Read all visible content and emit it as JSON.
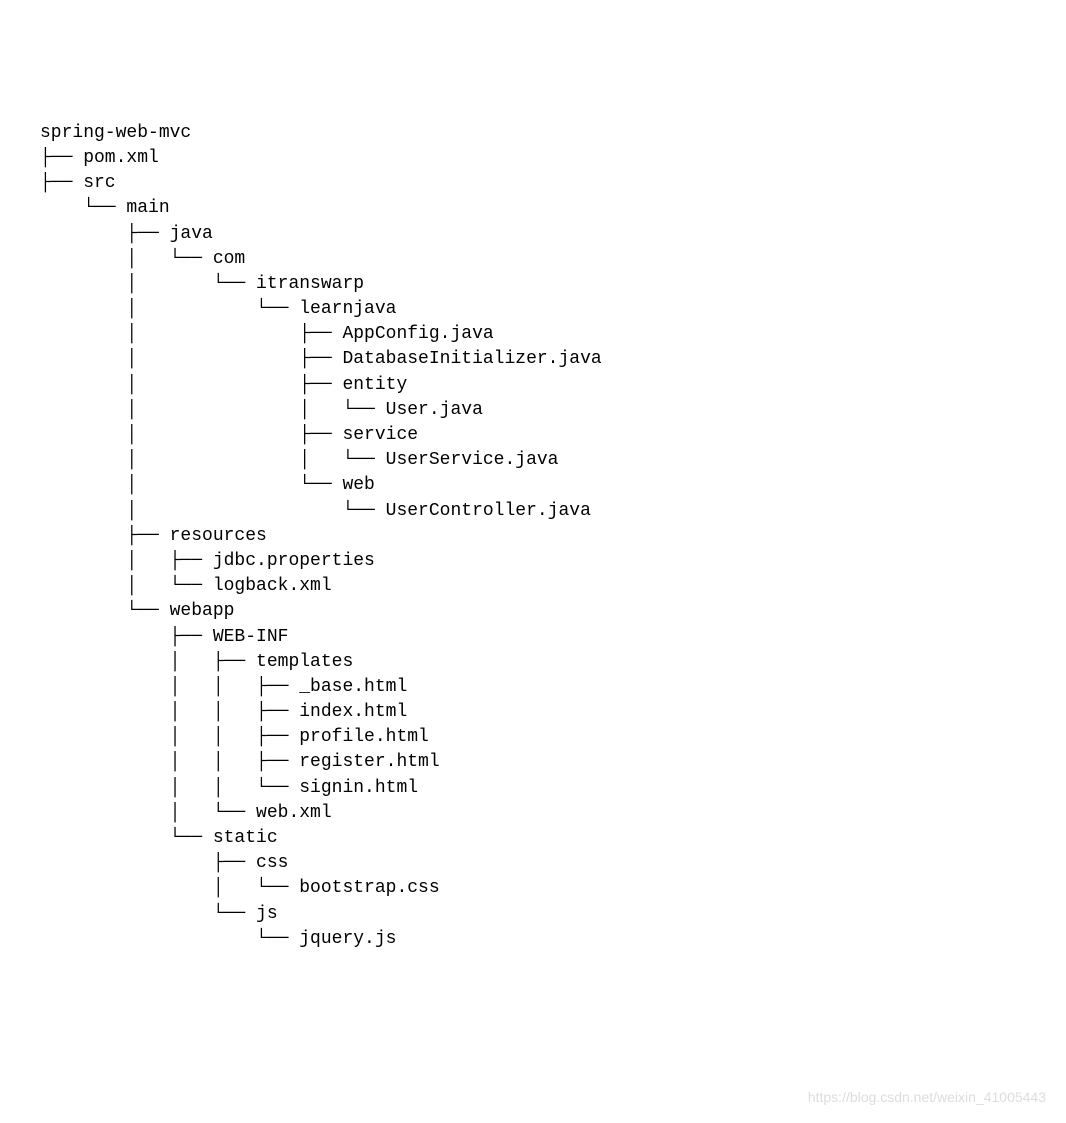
{
  "tree": {
    "lines": [
      "spring-web-mvc",
      "├── pom.xml",
      "├── src",
      "    └── main",
      "        ├── java",
      "        │   └── com",
      "        │       └── itranswarp",
      "        │           └── learnjava",
      "        │               ├── AppConfig.java",
      "        │               ├── DatabaseInitializer.java",
      "        │               ├── entity",
      "        │               │   └── User.java",
      "        │               ├── service",
      "        │               │   └── UserService.java",
      "        │               └── web",
      "        │                   └── UserController.java",
      "        ├── resources",
      "        │   ├── jdbc.properties",
      "        │   └── logback.xml",
      "        └── webapp",
      "            ├── WEB-INF",
      "            │   ├── templates",
      "            │   │   ├── _base.html",
      "            │   │   ├── index.html",
      "            │   │   ├── profile.html",
      "            │   │   ├── register.html",
      "            │   │   └── signin.html",
      "            │   └── web.xml",
      "            └── static",
      "                ├── css",
      "                │   └── bootstrap.css",
      "                └── js",
      "                    └── jquery.js"
    ]
  },
  "watermark": "https://blog.csdn.net/weixin_41005443"
}
